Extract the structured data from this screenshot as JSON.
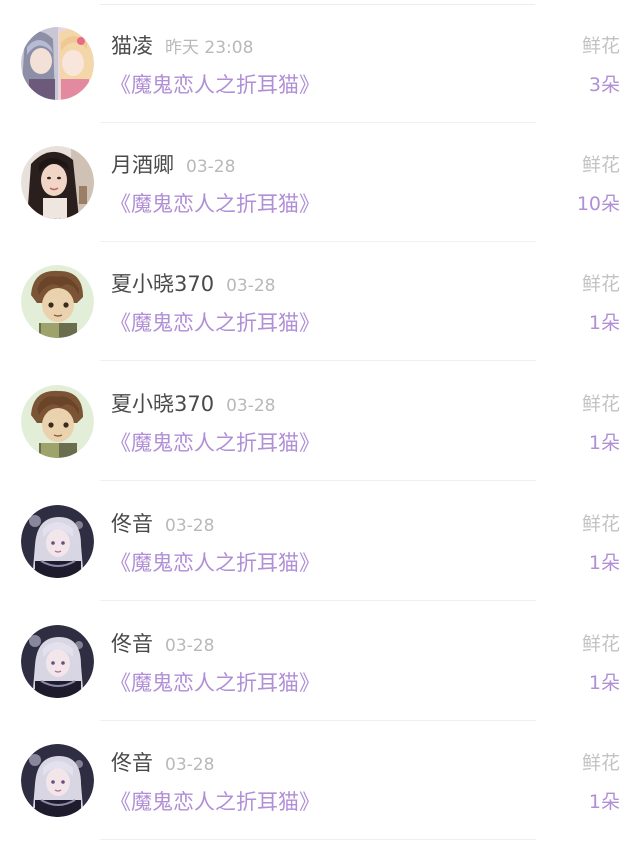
{
  "records": [
    {
      "name": "猫凌",
      "time": "昨天 23:08",
      "book": "《魔鬼恋人之折耳猫》",
      "gift": "鲜花",
      "count": "3朵",
      "avatar": "anime-duo-avatar-icon"
    },
    {
      "name": "月酒卿",
      "time": "03-28",
      "book": "《魔鬼恋人之折耳猫》",
      "gift": "鲜花",
      "count": "10朵",
      "avatar": "portrait-woman-avatar-icon"
    },
    {
      "name": "夏小晓370",
      "time": "03-28",
      "book": "《魔鬼恋人之折耳猫》",
      "gift": "鲜花",
      "count": "1朵",
      "avatar": "anime-boy-avatar-icon"
    },
    {
      "name": "夏小晓370",
      "time": "03-28",
      "book": "《魔鬼恋人之折耳猫》",
      "gift": "鲜花",
      "count": "1朵",
      "avatar": "anime-boy-avatar-icon"
    },
    {
      "name": "佟音",
      "time": "03-28",
      "book": "《魔鬼恋人之折耳猫》",
      "gift": "鲜花",
      "count": "1朵",
      "avatar": "gothic-doll-avatar-icon"
    },
    {
      "name": "佟音",
      "time": "03-28",
      "book": "《魔鬼恋人之折耳猫》",
      "gift": "鲜花",
      "count": "1朵",
      "avatar": "gothic-doll-avatar-icon"
    },
    {
      "name": "佟音",
      "time": "03-28",
      "book": "《魔鬼恋人之折耳猫》",
      "gift": "鲜花",
      "count": "1朵",
      "avatar": "gothic-doll-avatar-icon"
    }
  ],
  "colors": {
    "name": "#4a4a4a",
    "time": "#b9b9b9",
    "accent": "#b08fd6",
    "gift_label": "#c3c3c3",
    "divider": "#f0f0f0"
  }
}
